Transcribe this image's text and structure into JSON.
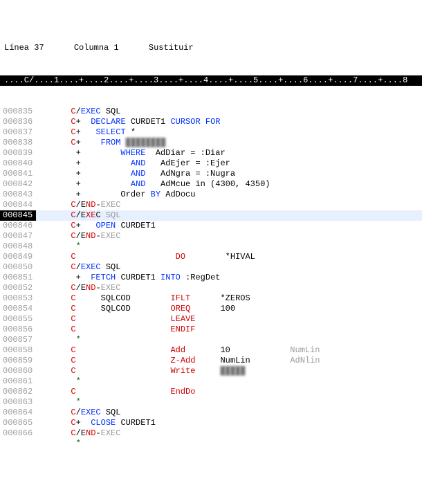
{
  "status": {
    "linea_label": "Línea",
    "linea_value": "37",
    "columna_label": "Columna",
    "columna_value": "1",
    "mode": "Sustituir"
  },
  "ruler_text": "....C/....1....+....2....+....3....+....4....+....5....+....6....+....7....+....8",
  "lines": [
    {
      "num": "000835",
      "parts": [
        {
          "t": "       ",
          "c": "black"
        },
        {
          "t": "C",
          "c": "red"
        },
        {
          "t": "/",
          "c": "black"
        },
        {
          "t": "EXEC ",
          "c": "blue"
        },
        {
          "t": "SQL",
          "c": "black"
        }
      ]
    },
    {
      "num": "000836",
      "parts": [
        {
          "t": "       ",
          "c": "black"
        },
        {
          "t": "C",
          "c": "red"
        },
        {
          "t": "+  ",
          "c": "black"
        },
        {
          "t": "DECLARE ",
          "c": "blue"
        },
        {
          "t": "CURDET1 ",
          "c": "black"
        },
        {
          "t": "CURSOR FOR",
          "c": "blue"
        }
      ]
    },
    {
      "num": "000837",
      "parts": [
        {
          "t": "       ",
          "c": "black"
        },
        {
          "t": "C",
          "c": "red"
        },
        {
          "t": "+   ",
          "c": "black"
        },
        {
          "t": "SELECT ",
          "c": "blue"
        },
        {
          "t": "*",
          "c": "black"
        }
      ]
    },
    {
      "num": "000838",
      "parts": [
        {
          "t": "       ",
          "c": "black"
        },
        {
          "t": "C",
          "c": "red"
        },
        {
          "t": "+    ",
          "c": "black"
        },
        {
          "t": "FROM ",
          "c": "blue"
        },
        {
          "t": "████████",
          "c": "blur"
        }
      ]
    },
    {
      "num": "000839",
      "parts": [
        {
          "t": "        +        ",
          "c": "black"
        },
        {
          "t": "WHERE",
          "c": "blue"
        },
        {
          "t": "  AdDiar = :Diar",
          "c": "black"
        }
      ]
    },
    {
      "num": "000840",
      "parts": [
        {
          "t": "        +          ",
          "c": "black"
        },
        {
          "t": "AND",
          "c": "blue"
        },
        {
          "t": "   AdEjer = :Ejer",
          "c": "black"
        }
      ]
    },
    {
      "num": "000841",
      "parts": [
        {
          "t": "        +          ",
          "c": "black"
        },
        {
          "t": "AND",
          "c": "blue"
        },
        {
          "t": "   AdNgra = :Nugra",
          "c": "black"
        }
      ]
    },
    {
      "num": "000842",
      "parts": [
        {
          "t": "        +          ",
          "c": "black"
        },
        {
          "t": "AND",
          "c": "blue"
        },
        {
          "t": "   AdMcue in (4300, 4350)",
          "c": "black"
        }
      ]
    },
    {
      "num": "000843",
      "parts": [
        {
          "t": "        +        Order ",
          "c": "black"
        },
        {
          "t": "BY",
          "c": "blue"
        },
        {
          "t": " AdDocu",
          "c": "black"
        }
      ]
    },
    {
      "num": "000844",
      "parts": [
        {
          "t": "       ",
          "c": "black"
        },
        {
          "t": "C",
          "c": "red"
        },
        {
          "t": "/E",
          "c": "black"
        },
        {
          "t": "ND",
          "c": "red"
        },
        {
          "t": "-",
          "c": "black"
        },
        {
          "t": "EXEC",
          "c": "gray"
        }
      ]
    },
    {
      "num": "000845",
      "hl": true,
      "parts": [
        {
          "t": "       ",
          "c": "black"
        },
        {
          "t": "C",
          "c": "red"
        },
        {
          "t": "/E",
          "c": "black"
        },
        {
          "t": "XE",
          "c": "red"
        },
        {
          "t": "C ",
          "c": "black"
        },
        {
          "t": "SQL",
          "c": "gray"
        }
      ]
    },
    {
      "num": "000846",
      "parts": [
        {
          "t": "       ",
          "c": "black"
        },
        {
          "t": "C",
          "c": "red"
        },
        {
          "t": "+   ",
          "c": "black"
        },
        {
          "t": "OPEN",
          "c": "blue"
        },
        {
          "t": " CURDET1",
          "c": "black"
        }
      ]
    },
    {
      "num": "000847",
      "parts": [
        {
          "t": "       ",
          "c": "black"
        },
        {
          "t": "C",
          "c": "red"
        },
        {
          "t": "/E",
          "c": "black"
        },
        {
          "t": "ND",
          "c": "red"
        },
        {
          "t": "-",
          "c": "black"
        },
        {
          "t": "EXEC",
          "c": "gray"
        }
      ]
    },
    {
      "num": "000848",
      "parts": [
        {
          "t": "        ",
          "c": "black"
        },
        {
          "t": "*",
          "c": "green"
        }
      ]
    },
    {
      "num": "000849",
      "parts": [
        {
          "t": "       ",
          "c": "black"
        },
        {
          "t": "C",
          "c": "red"
        },
        {
          "t": "                    ",
          "c": "black"
        },
        {
          "t": "DO",
          "c": "red"
        },
        {
          "t": "        *HIVAL",
          "c": "black"
        }
      ]
    },
    {
      "num": "000850",
      "parts": [
        {
          "t": "       ",
          "c": "black"
        },
        {
          "t": "C",
          "c": "red"
        },
        {
          "t": "/",
          "c": "black"
        },
        {
          "t": "EXEC ",
          "c": "blue"
        },
        {
          "t": "SQL",
          "c": "black"
        }
      ]
    },
    {
      "num": "000851",
      "parts": [
        {
          "t": "        +  ",
          "c": "black"
        },
        {
          "t": "FETCH ",
          "c": "blue"
        },
        {
          "t": "CURDET1 ",
          "c": "black"
        },
        {
          "t": "INTO ",
          "c": "blue"
        },
        {
          "t": ":RegDet",
          "c": "black"
        }
      ]
    },
    {
      "num": "000852",
      "parts": [
        {
          "t": "       ",
          "c": "black"
        },
        {
          "t": "C",
          "c": "red"
        },
        {
          "t": "/E",
          "c": "black"
        },
        {
          "t": "ND",
          "c": "red"
        },
        {
          "t": "-",
          "c": "black"
        },
        {
          "t": "EXEC",
          "c": "gray"
        }
      ]
    },
    {
      "num": "000853",
      "parts": [
        {
          "t": "       ",
          "c": "black"
        },
        {
          "t": "C",
          "c": "red"
        },
        {
          "t": "     SQLCOD        ",
          "c": "black"
        },
        {
          "t": "IFLT",
          "c": "red"
        },
        {
          "t": "      *ZEROS",
          "c": "black"
        }
      ]
    },
    {
      "num": "000854",
      "parts": [
        {
          "t": "       ",
          "c": "black"
        },
        {
          "t": "C",
          "c": "red"
        },
        {
          "t": "     SQLCOD        ",
          "c": "black"
        },
        {
          "t": "OREQ",
          "c": "red"
        },
        {
          "t": "      100",
          "c": "black"
        }
      ]
    },
    {
      "num": "000855",
      "parts": [
        {
          "t": "       ",
          "c": "black"
        },
        {
          "t": "C",
          "c": "red"
        },
        {
          "t": "                   ",
          "c": "black"
        },
        {
          "t": "LEAVE",
          "c": "red"
        }
      ]
    },
    {
      "num": "000856",
      "parts": [
        {
          "t": "       ",
          "c": "black"
        },
        {
          "t": "C",
          "c": "red"
        },
        {
          "t": "                   ",
          "c": "black"
        },
        {
          "t": "ENDIF",
          "c": "red"
        }
      ]
    },
    {
      "num": "000857",
      "parts": [
        {
          "t": "        ",
          "c": "black"
        },
        {
          "t": "*",
          "c": "green"
        }
      ]
    },
    {
      "num": "000858",
      "parts": [
        {
          "t": "       ",
          "c": "black"
        },
        {
          "t": "C",
          "c": "red"
        },
        {
          "t": "                   ",
          "c": "black"
        },
        {
          "t": "Add",
          "c": "red"
        },
        {
          "t": "       10            ",
          "c": "black"
        },
        {
          "t": "NumLin",
          "c": "gray"
        }
      ]
    },
    {
      "num": "000859",
      "parts": [
        {
          "t": "       ",
          "c": "black"
        },
        {
          "t": "C",
          "c": "red"
        },
        {
          "t": "                   ",
          "c": "black"
        },
        {
          "t": "Z-Add",
          "c": "red"
        },
        {
          "t": "     NumLin        ",
          "c": "black"
        },
        {
          "t": "AdNlin",
          "c": "gray"
        }
      ]
    },
    {
      "num": "000860",
      "parts": [
        {
          "t": "       ",
          "c": "black"
        },
        {
          "t": "C",
          "c": "red"
        },
        {
          "t": "                   ",
          "c": "black"
        },
        {
          "t": "Write",
          "c": "red"
        },
        {
          "t": "     ",
          "c": "black"
        },
        {
          "t": "█████",
          "c": "blur"
        }
      ]
    },
    {
      "num": "000861",
      "parts": [
        {
          "t": "        ",
          "c": "black"
        },
        {
          "t": "*",
          "c": "green"
        }
      ]
    },
    {
      "num": "000862",
      "parts": [
        {
          "t": "       ",
          "c": "black"
        },
        {
          "t": "C",
          "c": "red"
        },
        {
          "t": "                   ",
          "c": "black"
        },
        {
          "t": "EndDo",
          "c": "red"
        }
      ]
    },
    {
      "num": "000863",
      "parts": [
        {
          "t": "        ",
          "c": "black"
        },
        {
          "t": "*",
          "c": "green"
        }
      ]
    },
    {
      "num": "000864",
      "parts": [
        {
          "t": "       ",
          "c": "black"
        },
        {
          "t": "C",
          "c": "red"
        },
        {
          "t": "/",
          "c": "black"
        },
        {
          "t": "EXEC ",
          "c": "blue"
        },
        {
          "t": "SQL",
          "c": "black"
        }
      ]
    },
    {
      "num": "000865",
      "parts": [
        {
          "t": "       ",
          "c": "black"
        },
        {
          "t": "C",
          "c": "red"
        },
        {
          "t": "+  ",
          "c": "black"
        },
        {
          "t": "CLOSE",
          "c": "blue"
        },
        {
          "t": " CURDET1",
          "c": "black"
        }
      ]
    },
    {
      "num": "000866",
      "parts": [
        {
          "t": "       ",
          "c": "black"
        },
        {
          "t": "C",
          "c": "red"
        },
        {
          "t": "/E",
          "c": "black"
        },
        {
          "t": "ND",
          "c": "red"
        },
        {
          "t": "-",
          "c": "black"
        },
        {
          "t": "EXEC",
          "c": "gray"
        }
      ]
    }
  ],
  "last_partial_line": {
    "gutter": "      ",
    "text": "        *",
    "c": "green"
  }
}
